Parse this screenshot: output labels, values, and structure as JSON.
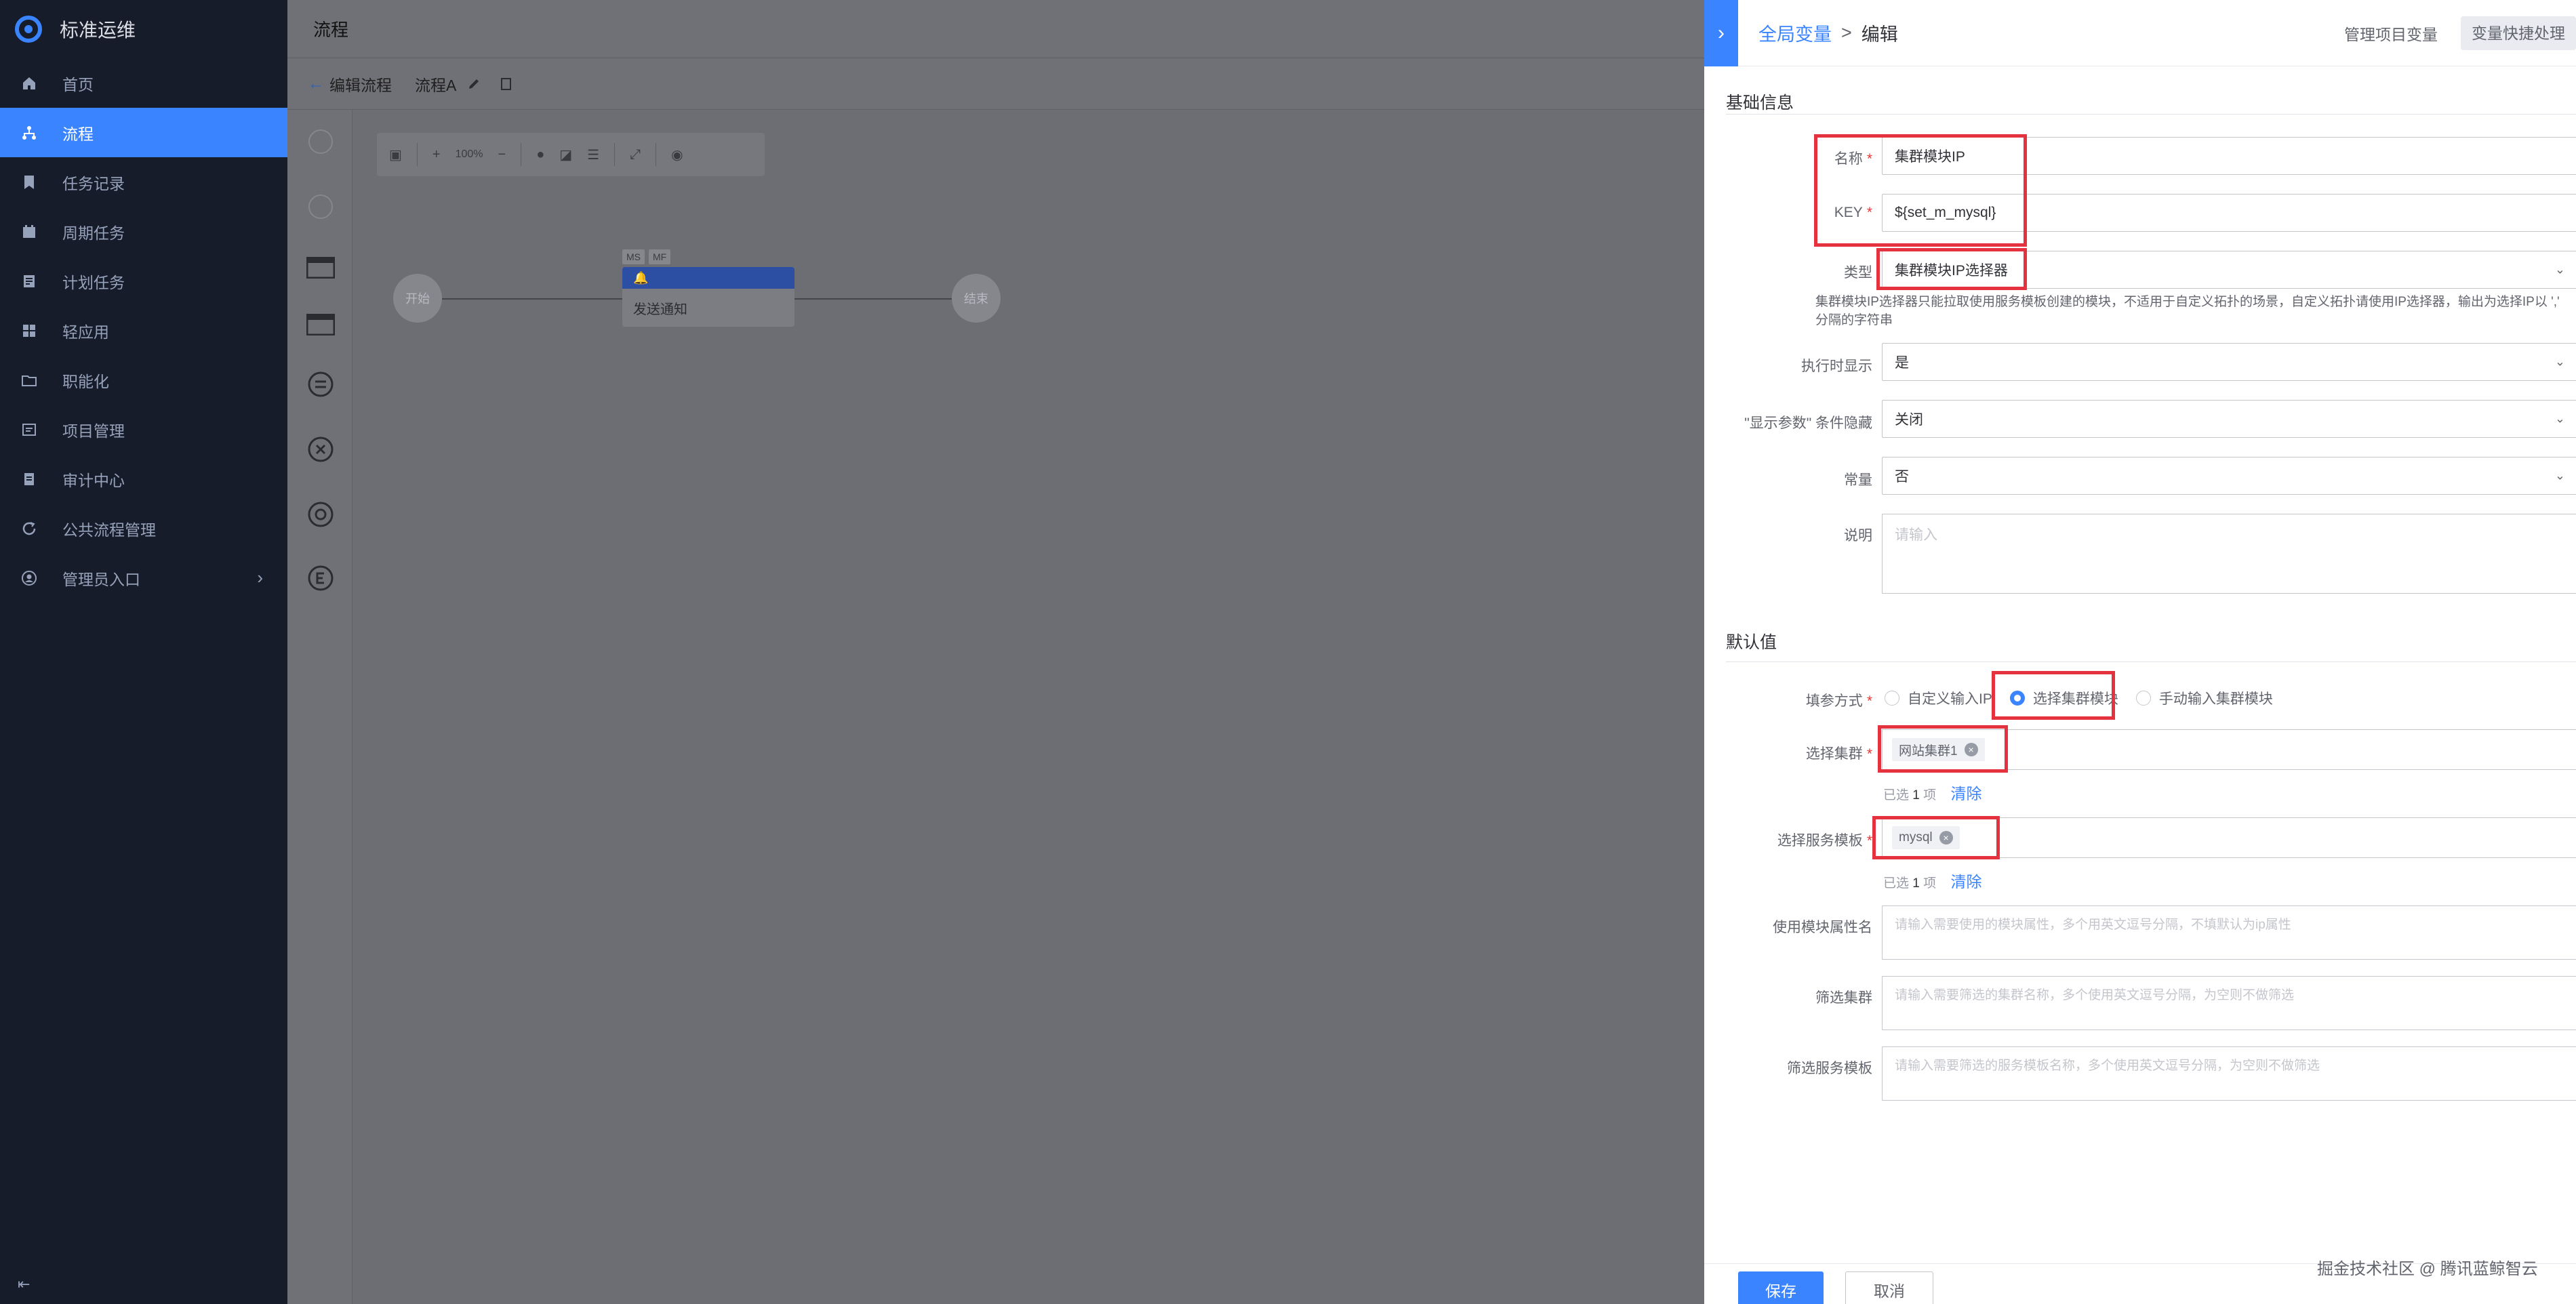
{
  "app": {
    "name": "标准运维"
  },
  "sidebar": {
    "items": [
      {
        "label": "首页",
        "icon": "home-icon"
      },
      {
        "label": "流程",
        "icon": "flow-icon",
        "active": true
      },
      {
        "label": "任务记录",
        "icon": "bookmark-icon"
      },
      {
        "label": "周期任务",
        "icon": "calendar-icon"
      },
      {
        "label": "计划任务",
        "icon": "plan-icon"
      },
      {
        "label": "轻应用",
        "icon": "apps-icon"
      },
      {
        "label": "职能化",
        "icon": "folder-icon"
      },
      {
        "label": "项目管理",
        "icon": "project-icon"
      },
      {
        "label": "审计中心",
        "icon": "audit-icon"
      },
      {
        "label": "公共流程管理",
        "icon": "refresh-icon"
      },
      {
        "label": "管理员入口",
        "icon": "user-icon",
        "has_children": true
      }
    ],
    "collapse_icon": "collapse-icon"
  },
  "topbar": {
    "title": "流程"
  },
  "subbar": {
    "back_label": "编辑流程",
    "flow_name": "流程A"
  },
  "canvas": {
    "zoom": "100%",
    "start_node": "开始",
    "end_node": "结束",
    "task": {
      "tags": [
        "MS",
        "MF"
      ],
      "name": "发送通知"
    }
  },
  "panel": {
    "breadcrumb": {
      "parent": "全局变量",
      "separator": ">",
      "current": "编辑"
    },
    "header_link": "管理项目变量",
    "header_button": "变量快捷处理",
    "basic_section": "基础信息",
    "fields": {
      "name": {
        "label": "名称",
        "value": "集群模块IP"
      },
      "key": {
        "label": "KEY",
        "value": "${set_m_mysql}"
      },
      "type": {
        "label": "类型",
        "value": "集群模块IP选择器"
      },
      "type_help": "集群模块IP选择器只能拉取使用服务模板创建的模块，不适用于自定义拓扑的场景，自定义拓扑请使用IP选择器，输出为选择IP以 ',' 分隔的字符串",
      "show_on_exec": {
        "label": "执行时显示",
        "value": "是"
      },
      "hide_condition": {
        "label": "\"显示参数\" 条件隐藏",
        "value": "关闭"
      },
      "constant": {
        "label": "常量",
        "value": "否"
      },
      "description": {
        "label": "说明",
        "placeholder": "请输入"
      }
    },
    "default_section": "默认值",
    "default": {
      "fill_mode": {
        "label": "填参方式",
        "options": [
          "自定义输入IP",
          "选择集群模块",
          "手动输入集群模块"
        ],
        "selected": 1
      },
      "cluster": {
        "label": "选择集群",
        "tag": "网站集群1",
        "count_prefix": "已选",
        "count": "1",
        "count_suffix": "项",
        "clear": "清除"
      },
      "service_template": {
        "label": "选择服务模板",
        "tag": "mysql",
        "count_prefix": "已选",
        "count": "1",
        "count_suffix": "项",
        "clear": "清除"
      },
      "module_attr": {
        "label": "使用模块属性名",
        "placeholder": "请输入需要使用的模块属性，多个用英文逗号分隔，不填默认为ip属性"
      },
      "filter_cluster": {
        "label": "筛选集群",
        "placeholder": "请输入需要筛选的集群名称，多个使用英文逗号分隔，为空则不做筛选"
      },
      "filter_template": {
        "label": "筛选服务模板",
        "placeholder": "请输入需要筛选的服务模板名称，多个使用英文逗号分隔，为空则不做筛选"
      }
    },
    "footer": {
      "save": "保存",
      "cancel": "取消"
    }
  },
  "watermark": "掘金技术社区 @ 腾讯蓝鲸智云",
  "colors": {
    "primary": "#3a84ff",
    "sidebar_bg": "#171c2b",
    "highlight_box": "#e5323f",
    "required": "#ea3636"
  }
}
